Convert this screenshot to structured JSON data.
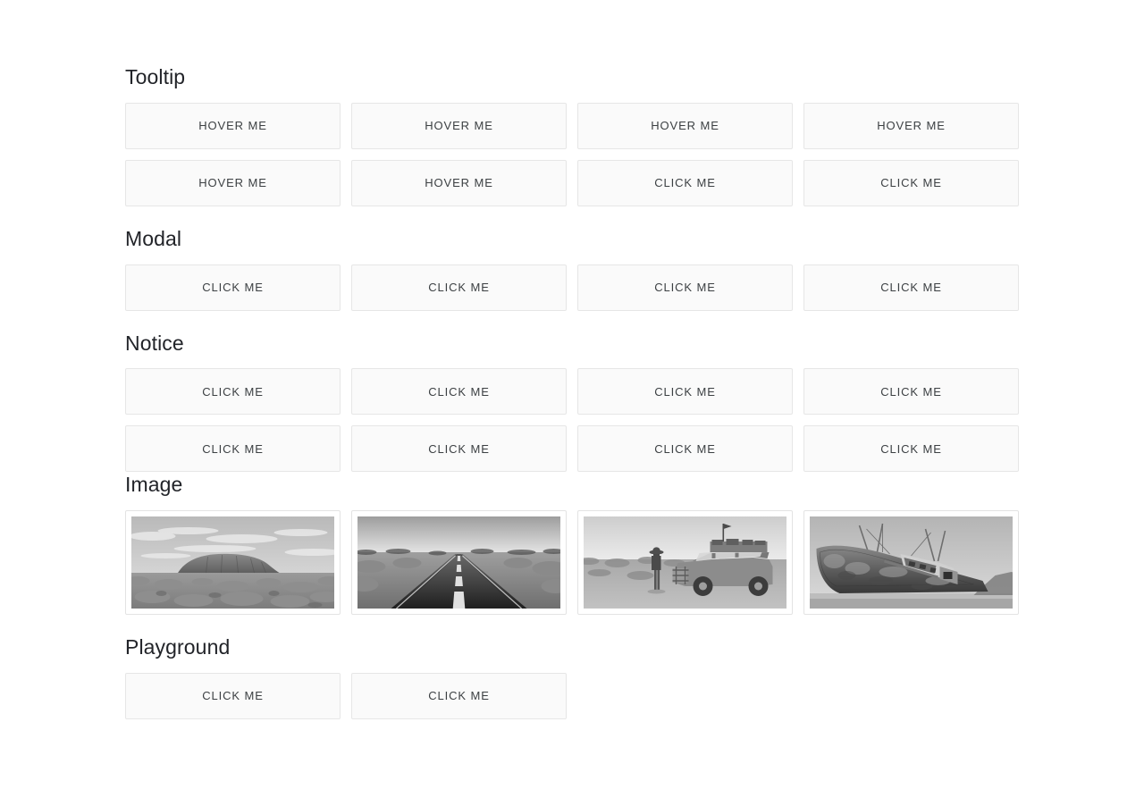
{
  "sections": [
    {
      "id": "tooltip",
      "title": "Tooltip",
      "rows": [
        [
          "HOVER ME",
          "HOVER ME",
          "HOVER ME",
          "HOVER ME"
        ],
        [
          "HOVER ME",
          "HOVER ME",
          "CLICK ME",
          "CLICK ME"
        ]
      ]
    },
    {
      "id": "modal",
      "title": "Modal",
      "rows": [
        [
          "CLICK ME",
          "CLICK ME",
          "CLICK ME",
          "CLICK ME"
        ]
      ]
    },
    {
      "id": "notice",
      "title": "Notice",
      "rows": [
        [
          "CLICK ME",
          "CLICK ME",
          "CLICK ME",
          "CLICK ME"
        ],
        [
          "CLICK ME",
          "CLICK ME",
          "CLICK ME",
          "CLICK ME"
        ]
      ]
    }
  ],
  "image_section": {
    "id": "image",
    "title": "Image",
    "items": [
      {
        "name": "uluru-rock-photo",
        "alt": "Uluru rock formation in the outback"
      },
      {
        "name": "outback-road-photo",
        "alt": "Straight desert road to the horizon"
      },
      {
        "name": "four-wheel-drive-photo",
        "alt": "Person standing beside a loaded 4WD vehicle"
      },
      {
        "name": "shipwreck-photo",
        "alt": "Rusted shipwreck beached on the shore"
      }
    ]
  },
  "playground_section": {
    "id": "playground",
    "title": "Playground",
    "buttons": [
      "CLICK ME",
      "CLICK ME"
    ]
  },
  "colors": {
    "page_background": "#ffffff",
    "button_background": "#fafafa",
    "button_border": "#e6e6e6",
    "text": "#3c4043",
    "heading": "#222429",
    "frame_border": "#e3e3e3"
  }
}
